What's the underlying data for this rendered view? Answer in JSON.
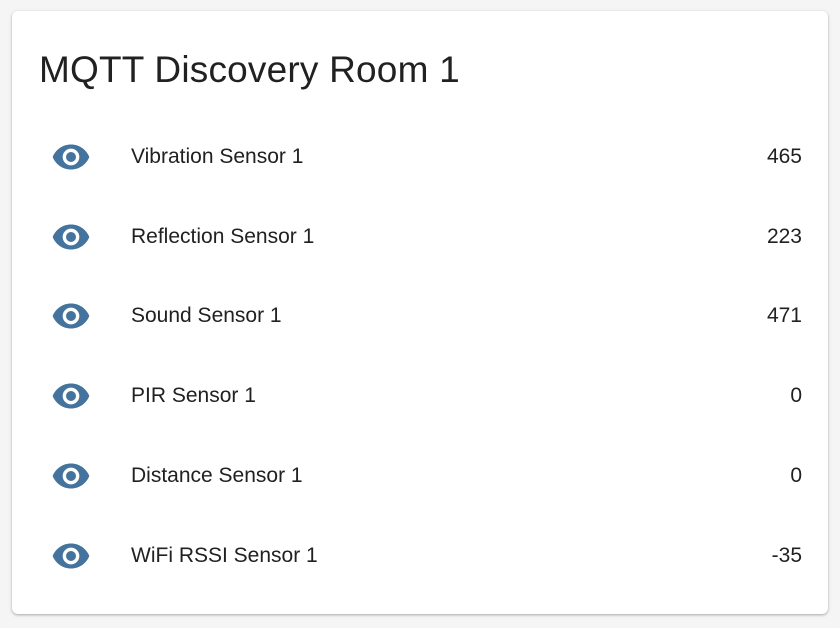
{
  "card": {
    "title": "MQTT Discovery Room 1"
  },
  "colors": {
    "icon": "#44739e",
    "text": "#212121",
    "background": "#f5f5f5",
    "card": "#ffffff"
  },
  "entities": [
    {
      "icon": "eye-icon",
      "name": "Vibration Sensor 1",
      "state": "465"
    },
    {
      "icon": "eye-icon",
      "name": "Reflection Sensor 1",
      "state": "223"
    },
    {
      "icon": "eye-icon",
      "name": "Sound Sensor 1",
      "state": "471"
    },
    {
      "icon": "eye-icon",
      "name": "PIR Sensor 1",
      "state": "0"
    },
    {
      "icon": "eye-icon",
      "name": "Distance Sensor 1",
      "state": "0"
    },
    {
      "icon": "eye-icon",
      "name": "WiFi RSSI Sensor 1",
      "state": "-35"
    }
  ]
}
